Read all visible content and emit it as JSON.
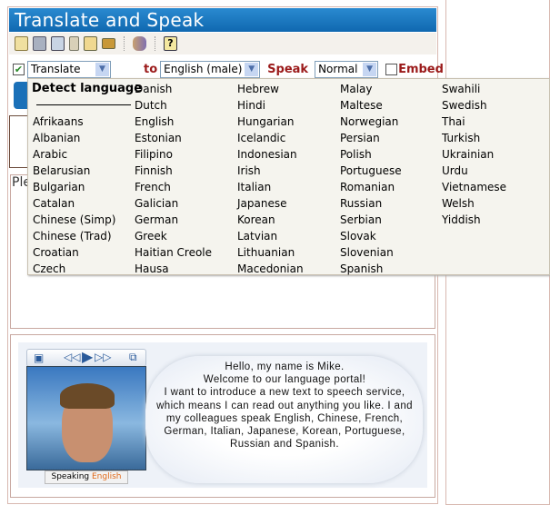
{
  "app": {
    "title": "Translate and Speak"
  },
  "toolbar": {
    "icons": [
      "new-document-icon",
      "print-icon",
      "cut-icon",
      "delete-icon",
      "spell-check-icon",
      "keyboard-icon",
      "speak-icon",
      "help-icon"
    ]
  },
  "controls": {
    "translate_checked": true,
    "mode_value": "Translate",
    "to_label": "to",
    "target_value": "English (male)",
    "speak_label": "Speak",
    "speed_value": "Normal",
    "embed_checked": false,
    "embed_label": "Embed"
  },
  "textarea": {
    "partial_text": "Ple"
  },
  "dropdown": {
    "detect": "Detect language",
    "columns": [
      [
        "Afrikaans",
        "Albanian",
        "Arabic",
        "Belarusian",
        "Bulgarian",
        "Catalan",
        "Chinese (Simp)",
        "Chinese (Trad)",
        "Croatian",
        "Czech"
      ],
      [
        "Danish",
        "Dutch",
        "English",
        "Estonian",
        "Filipino",
        "Finnish",
        "French",
        "Galician",
        "German",
        "Greek",
        "Haitian Creole",
        "Hausa"
      ],
      [
        "Hebrew",
        "Hindi",
        "Hungarian",
        "Icelandic",
        "Indonesian",
        "Irish",
        "Italian",
        "Japanese",
        "Korean",
        "Latvian",
        "Lithuanian",
        "Macedonian"
      ],
      [
        "Malay",
        "Maltese",
        "Norwegian",
        "Persian",
        "Polish",
        "Portuguese",
        "Romanian",
        "Russian",
        "Serbian",
        "Slovak",
        "Slovenian",
        "Spanish"
      ],
      [
        "Swahili",
        "Swedish",
        "Thai",
        "Turkish",
        "Ukrainian",
        "Urdu",
        "Vietnamese",
        "Welsh",
        "Yiddish"
      ]
    ]
  },
  "avatar": {
    "speaking_label": "Speaking",
    "speaking_lang": "English",
    "message": "Hello, my name is Mike.\nWelcome to our language portal!\nI want to introduce a new text to speech service, which means I can read out anything you like. I and my colleagues speak English, Chinese, French, German, Italian, Japanese, Korean, Portuguese, Russian and Spanish."
  },
  "colors": {
    "title_bar": "#1a78c0",
    "label_red": "#9b1a1a",
    "speaking_lang": "#e06a1a"
  }
}
